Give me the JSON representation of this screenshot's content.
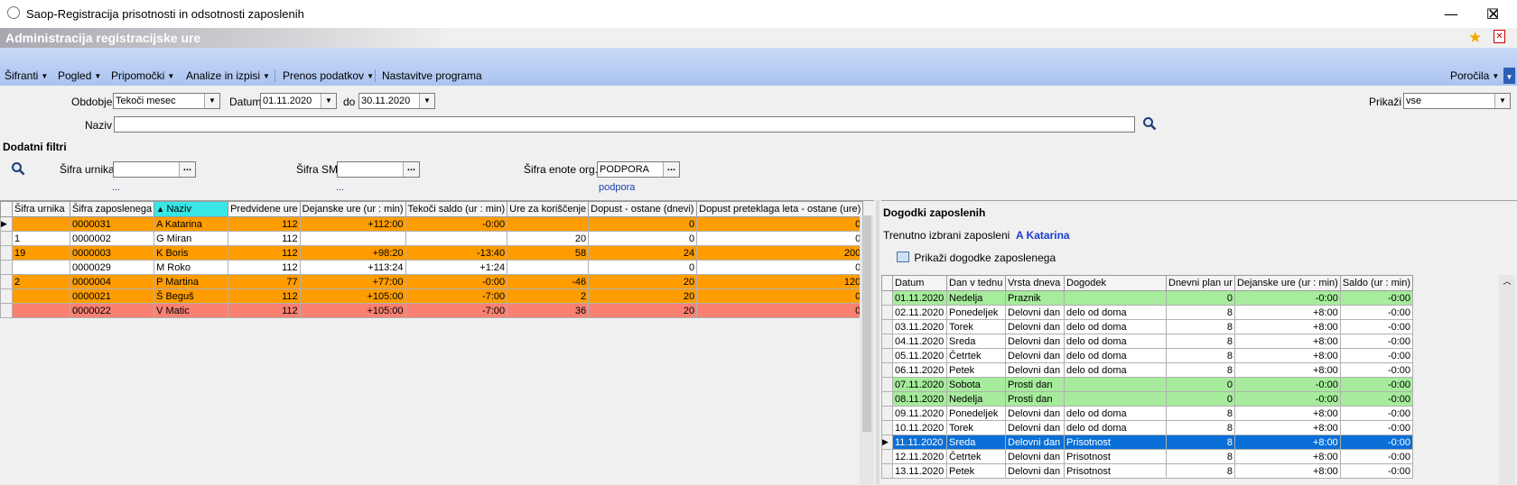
{
  "window": {
    "title": "Saop-Registracija prisotnosti in odsotnosti zaposlenih",
    "minimize": "—",
    "maximize": "☐",
    "close": "✕"
  },
  "app_header": "Administracija registracijske ure",
  "menu": [
    {
      "label": "Šifranti",
      "caret": true
    },
    {
      "label": "Pogled",
      "caret": true
    },
    {
      "label": "Pripomočki",
      "caret": true
    },
    {
      "label": "Analize in izpisi",
      "caret": true
    },
    {
      "label": "Prenos podatkov",
      "caret": true
    },
    {
      "label": "Nastavitve programa",
      "caret": false
    }
  ],
  "menu_right": "Poročila",
  "filters": {
    "obdobje_label": "Obdobje",
    "obdobje_value": "Tekoči mesec",
    "datum_label": "Datum",
    "datum_from": "01.11.2020",
    "do_label": "do",
    "datum_to": "30.11.2020",
    "naziv_label": "Naziv",
    "naziv_value": "",
    "prikazi_label": "Prikaži",
    "prikazi_value": "vse"
  },
  "extra_filters": {
    "title": "Dodatni filtri",
    "urnik_label": "Šifra urnika",
    "urnik_value": "",
    "urnik_link": "...",
    "sm_label": "Šifra SM",
    "sm_value": "",
    "sm_link": "...",
    "org_label": "Šifra enote org.",
    "org_value": "PODPORA",
    "org_link": "podpora"
  },
  "employees": {
    "columns": [
      "Šifra urnika",
      "Šifra zaposlenega",
      "Naziv",
      "Predvidene ure",
      "Dejanske ure (ur : min)",
      "Tekoči saldo (ur : min)",
      "Ure za koriščenje",
      "Dopust - ostane (dnevi)",
      "Dopust preteklaga leta - ostane (ure)"
    ],
    "rows": [
      {
        "style": "orange",
        "indicator": "▶",
        "cells": [
          "",
          "0000031",
          "A Katarina",
          "112",
          "+112:00",
          "-0:00",
          "",
          "0",
          "0"
        ]
      },
      {
        "style": "white",
        "indicator": "",
        "cells": [
          "1",
          "0000002",
          "G Miran",
          "112",
          "",
          "",
          "20",
          "0",
          "0"
        ]
      },
      {
        "style": "orange",
        "indicator": "",
        "cells": [
          "19",
          "0000003",
          "K Boris",
          "112",
          "+98:20",
          "-13:40",
          "58",
          "24",
          "200"
        ]
      },
      {
        "style": "white",
        "indicator": "",
        "cells": [
          "",
          "0000029",
          "M Roko",
          "112",
          "+113:24",
          "+1:24",
          "",
          "0",
          "0"
        ]
      },
      {
        "style": "orange",
        "indicator": "",
        "cells": [
          "2",
          "0000004",
          "P Martina",
          "77",
          "+77:00",
          "-0:00",
          "-46",
          "20",
          "120"
        ]
      },
      {
        "style": "orange",
        "indicator": "",
        "cells": [
          "",
          "0000021",
          "Š Beguš",
          "112",
          "+105:00",
          "-7:00",
          "2",
          "20",
          "0"
        ]
      },
      {
        "style": "salmon",
        "indicator": "",
        "cells": [
          "",
          "0000022",
          "V Matic",
          "112",
          "+105:00",
          "-7:00",
          "36",
          "20",
          "0"
        ]
      }
    ]
  },
  "events": {
    "title": "Dogodki zaposlenih",
    "current_label": "Trenutno izbrani zaposleni",
    "current_value": "A Katarina",
    "show_button": "Prikaži dogodke zaposlenega",
    "columns": [
      "Datum",
      "Dan v tednu",
      "Vrsta dneva",
      "Dogodek",
      "Dnevni plan ur",
      "Dejanske ure (ur : min)",
      "Saldo (ur : min)"
    ],
    "rows": [
      {
        "style": "green",
        "indicator": "",
        "cells": [
          "01.11.2020",
          "Nedelja",
          "Praznik",
          "",
          "0",
          "-0:00",
          "-0:00"
        ]
      },
      {
        "style": "wrow",
        "indicator": "",
        "cells": [
          "02.11.2020",
          "Ponedeljek",
          "Delovni dan",
          "delo od doma",
          "8",
          "+8:00",
          "-0:00"
        ]
      },
      {
        "style": "wrow",
        "indicator": "",
        "cells": [
          "03.11.2020",
          "Torek",
          "Delovni dan",
          "delo od doma",
          "8",
          "+8:00",
          "-0:00"
        ]
      },
      {
        "style": "wrow",
        "indicator": "",
        "cells": [
          "04.11.2020",
          "Sreda",
          "Delovni dan",
          "delo od doma",
          "8",
          "+8:00",
          "-0:00"
        ]
      },
      {
        "style": "wrow",
        "indicator": "",
        "cells": [
          "05.11.2020",
          "Četrtek",
          "Delovni dan",
          "delo od doma",
          "8",
          "+8:00",
          "-0:00"
        ]
      },
      {
        "style": "wrow",
        "indicator": "",
        "cells": [
          "06.11.2020",
          "Petek",
          "Delovni dan",
          "delo od doma",
          "8",
          "+8:00",
          "-0:00"
        ]
      },
      {
        "style": "green",
        "indicator": "",
        "cells": [
          "07.11.2020",
          "Sobota",
          "Prosti dan",
          "",
          "0",
          "-0:00",
          "-0:00"
        ]
      },
      {
        "style": "green",
        "indicator": "",
        "cells": [
          "08.11.2020",
          "Nedelja",
          "Prosti dan",
          "",
          "0",
          "-0:00",
          "-0:00"
        ]
      },
      {
        "style": "wrow",
        "indicator": "",
        "cells": [
          "09.11.2020",
          "Ponedeljek",
          "Delovni dan",
          "delo od doma",
          "8",
          "+8:00",
          "-0:00"
        ]
      },
      {
        "style": "wrow",
        "indicator": "",
        "cells": [
          "10.11.2020",
          "Torek",
          "Delovni dan",
          "delo od doma",
          "8",
          "+8:00",
          "-0:00"
        ]
      },
      {
        "style": "sel",
        "indicator": "▶",
        "cells": [
          "11.11.2020",
          "Sreda",
          "Delovni dan",
          " Prisotnost",
          "8",
          "+8:00",
          "-0:00"
        ]
      },
      {
        "style": "wrow",
        "indicator": "",
        "cells": [
          "12.11.2020",
          "Četrtek",
          "Delovni dan",
          " Prisotnost",
          "8",
          "+8:00",
          "-0:00"
        ]
      },
      {
        "style": "wrow",
        "indicator": "",
        "cells": [
          "13.11.2020",
          "Petek",
          "Delovni dan",
          " Prisotnost",
          "8",
          "+8:00",
          "-0:00"
        ]
      }
    ]
  }
}
